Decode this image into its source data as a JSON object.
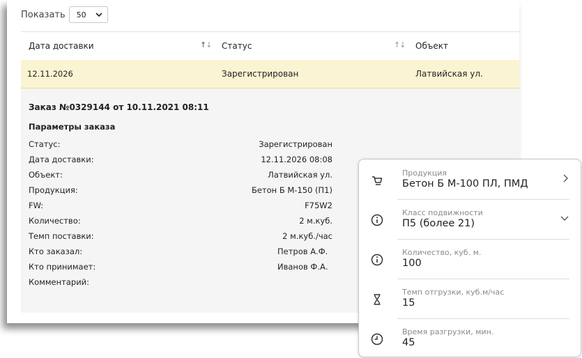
{
  "toolbar": {
    "show_label": "Показать",
    "page_size": "50"
  },
  "table": {
    "columns": [
      "Дата доставки",
      "Статус",
      "Объект"
    ],
    "row": {
      "date": "12.11.2026",
      "status": "Зарегистрирован",
      "object": "Латвийская ул."
    }
  },
  "details": {
    "title": "Заказ №0329144 от 10.11.2021 08:11",
    "subtitle": "Параметры заказа",
    "params": [
      {
        "label": "Статус:",
        "value": "Зарегистрирован"
      },
      {
        "label": "Дата доставки:",
        "value": "12.11.2026 08:08"
      },
      {
        "label": "Объект:",
        "value": "Латвийская ул."
      },
      {
        "label": "Продукция:",
        "value": "Бетон Б М-150 (П1)"
      },
      {
        "label": "FW:",
        "value": "F75W2"
      },
      {
        "label": "Количество:",
        "value": "2 м.куб."
      },
      {
        "label": "Темп поставки:",
        "value": "2 м.куб./час"
      },
      {
        "label": "Кто заказал:",
        "value": "Петров А.Ф."
      },
      {
        "label": "Кто принимает:",
        "value": "Иванов Ф.А."
      },
      {
        "label": "Комментарий:",
        "value": ""
      }
    ]
  },
  "panel": {
    "items": [
      {
        "label": "Продукция",
        "value": "Бетон Б М-100 ПЛ, ПМД",
        "icon": "cart-icon",
        "action": "chevron-right-icon"
      },
      {
        "label": "Класс подвижности",
        "value": "П5 (более 21)",
        "icon": "info-icon",
        "action": "chevron-down-icon"
      },
      {
        "label": "Количество, куб. м.",
        "value": "100",
        "icon": "info-icon"
      },
      {
        "label": "Темп отгрузки, куб.м/час",
        "value": "15",
        "icon": "hourglass-icon"
      },
      {
        "label": "Время разгрузки, мин.",
        "value": "45",
        "icon": "clock-icon"
      }
    ]
  }
}
